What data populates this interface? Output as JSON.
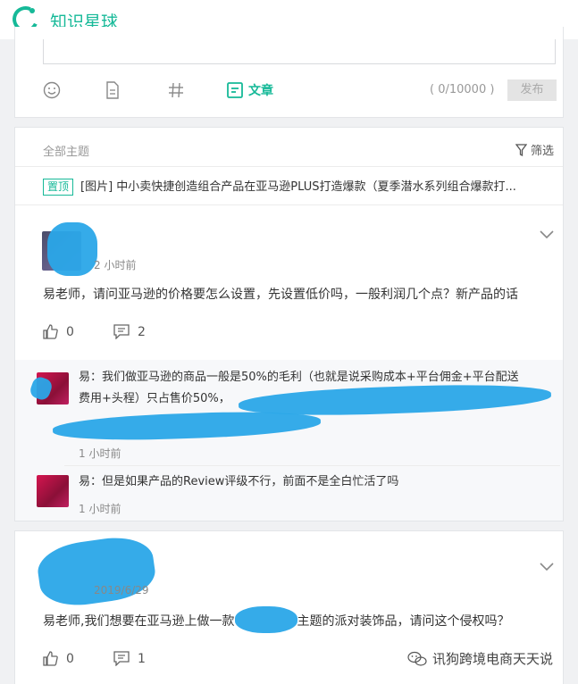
{
  "app": {
    "name": "知识星球"
  },
  "composer": {
    "article_label": "文章",
    "counter": "( 0/10000 )",
    "publish_label": "发布"
  },
  "feed": {
    "header": "全部主题",
    "filter_label": "筛选",
    "pinned": {
      "tag": "置顶",
      "text": "[图片] 中小卖快捷创造组合产品在亚马逊PLUS打造爆款（夏季潜水系列组合爆款打..."
    },
    "post1": {
      "time": "2 小时前",
      "text": "易老师，请问亚马逊的价格要怎么设置，先设置低价吗，一般利润几个点？新产品的话",
      "likes": "0",
      "comments": "2"
    },
    "comments": [
      {
        "line1": "易：我们做亚马逊的商品一般是50%的毛利（也就是说采购成本+平台佣金+平台配送",
        "line2": "费用+头程）只占售价50%，",
        "time": "1 小时前"
      },
      {
        "line1": "易：但是如果产品的Review评级不行，前面不是全白忙活了吗",
        "time": "1 小时前"
      }
    ]
  },
  "post2": {
    "date": "2019/6/29",
    "text_before": "易老师,我们想要在亚马逊上做一款",
    "text_after": "主题的派对装饰品，请问这个侵权吗？",
    "likes": "0",
    "comments": "1"
  },
  "watermark": "讯狗跨境电商天天说"
}
